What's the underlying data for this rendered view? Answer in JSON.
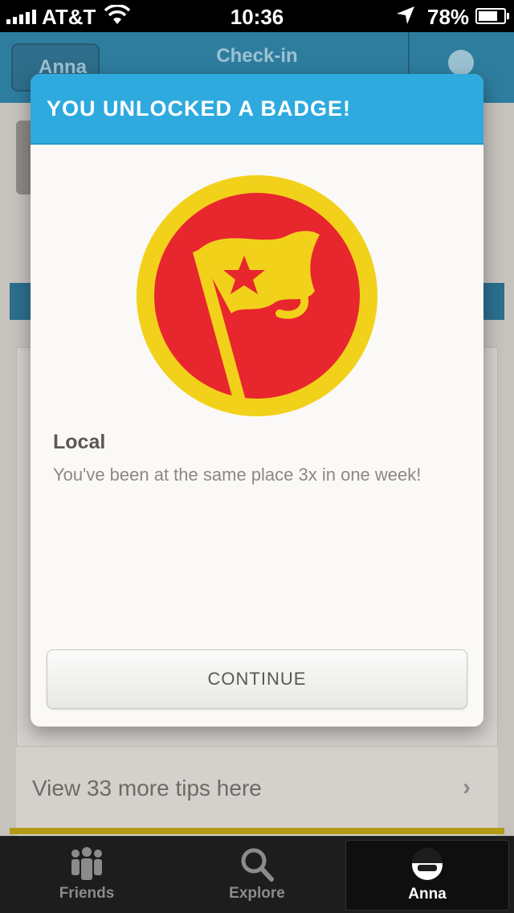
{
  "status_bar": {
    "carrier": "AT&T",
    "time": "10:36",
    "battery_percent": "78%",
    "battery_level": 0.78
  },
  "nav_bar": {
    "back_label": "Anna",
    "title": "Check-in"
  },
  "modal": {
    "title": "YOU UNLOCKED A BADGE!",
    "badge_name": "Local",
    "badge_description": "You've been at the same place 3x in one week!",
    "continue_label": "CONTINUE",
    "colors": {
      "header": "#2eaadf",
      "badge_ring": "#f2d11b",
      "badge_fill": "#e8262e"
    }
  },
  "background": {
    "tips_link": "View 33 more tips here"
  },
  "tab_bar": {
    "tabs": [
      {
        "label": "Friends",
        "icon": "friends-icon"
      },
      {
        "label": "Explore",
        "icon": "search-icon"
      },
      {
        "label": "Anna",
        "icon": "profile-icon"
      }
    ],
    "active": "Anna"
  }
}
